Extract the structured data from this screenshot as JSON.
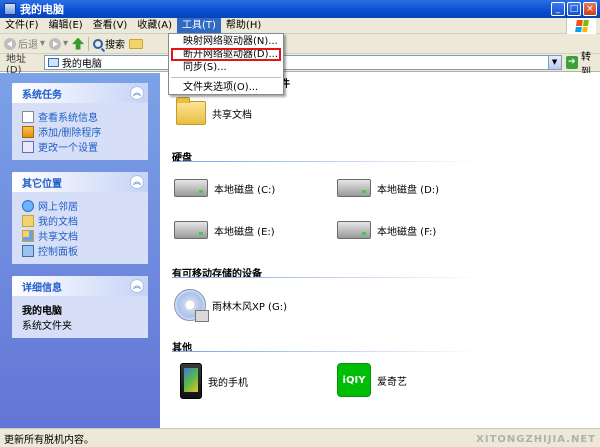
{
  "window": {
    "title": "我的电脑"
  },
  "menubar": {
    "items": [
      "文件(F)",
      "编辑(E)",
      "查看(V)",
      "收藏(A)",
      "工具(T)",
      "帮助(H)"
    ],
    "active_index": 4
  },
  "toolbar": {
    "back": "后退",
    "search": "搜索"
  },
  "address": {
    "label": "地址(D)",
    "value": "我的电脑",
    "go": "转到"
  },
  "tools_menu": {
    "items": [
      "映射网络驱动器(N)...",
      "断开网络驱动器(D)...",
      "同步(S)...",
      "文件夹选项(O)..."
    ],
    "highlighted_index": 1
  },
  "leftpane": {
    "system_tasks": {
      "title": "系统任务",
      "items": [
        "查看系统信息",
        "添加/删除程序",
        "更改一个设置"
      ]
    },
    "other_places": {
      "title": "其它位置",
      "items": [
        "网上邻居",
        "我的文档",
        "共享文档",
        "控制面板"
      ]
    },
    "details": {
      "title": "详细信息",
      "name": "我的电脑",
      "type": "系统文件夹"
    }
  },
  "content": {
    "section_files_suffix": "件",
    "shared_docs": "共享文档",
    "section_disks": "硬盘",
    "disks": [
      "本地磁盘 (C:)",
      "本地磁盘 (D:)",
      "本地磁盘 (E:)",
      "本地磁盘 (F:)"
    ],
    "section_removable": "有可移动存储的设备",
    "cd": "雨林木风XP (G:)",
    "section_other": "其他",
    "phone": "我的手机",
    "iqiyi": "爱奇艺",
    "iqiyi_logo": "iQIY"
  },
  "statusbar": {
    "text": "更新所有脱机内容。"
  },
  "watermark": {
    "text": "XITONGZHIJIA.NET"
  }
}
